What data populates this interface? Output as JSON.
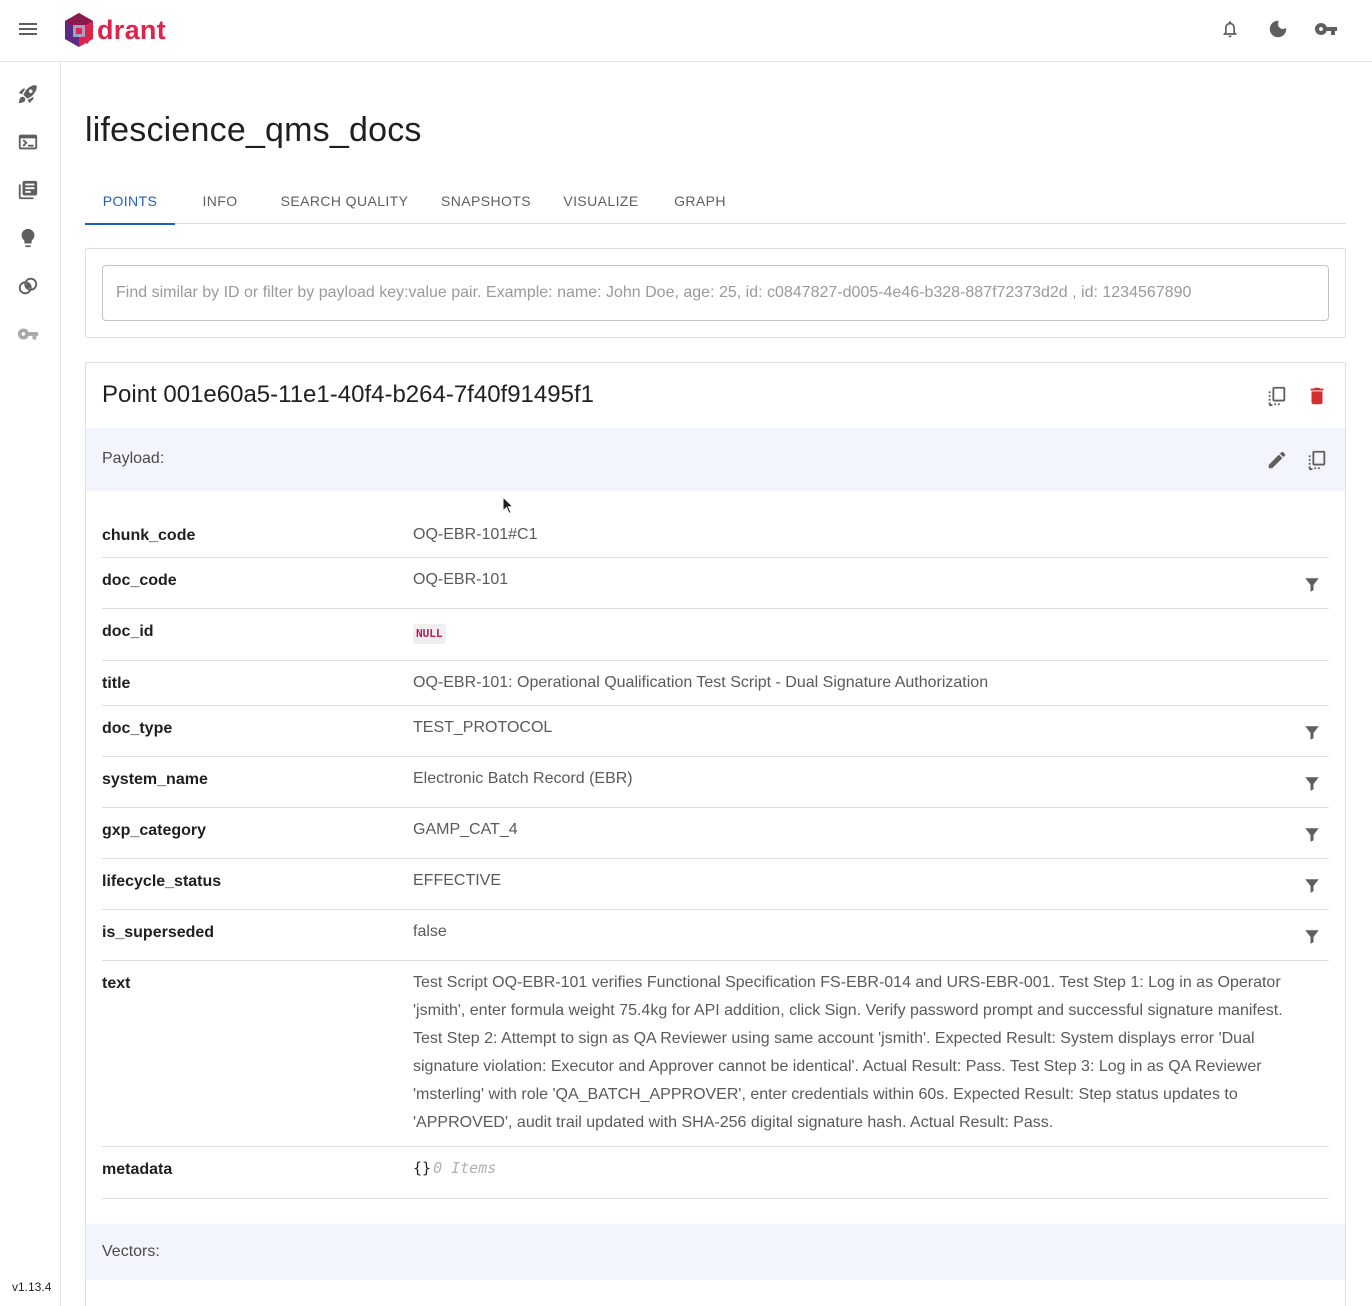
{
  "app": {
    "logo_text": "drant",
    "version": "v1.13.4"
  },
  "header": {
    "icons": [
      "bell-icon",
      "moon-icon",
      "key-icon"
    ]
  },
  "sidebar": {
    "items": [
      {
        "name": "welcome",
        "icon": "rocket-icon"
      },
      {
        "name": "console",
        "icon": "terminal-icon"
      },
      {
        "name": "collections",
        "icon": "library-icon"
      },
      {
        "name": "tutorial",
        "icon": "lightbulb-icon"
      },
      {
        "name": "datasets",
        "icon": "datasets-icon"
      },
      {
        "name": "access",
        "icon": "key-icon"
      }
    ]
  },
  "collection": {
    "title": "lifescience_qms_docs"
  },
  "tabs": [
    {
      "label": "POINTS",
      "active": true
    },
    {
      "label": "INFO",
      "active": false
    },
    {
      "label": "SEARCH QUALITY",
      "active": false
    },
    {
      "label": "SNAPSHOTS",
      "active": false
    },
    {
      "label": "VISUALIZE",
      "active": false
    },
    {
      "label": "GRAPH",
      "active": false
    }
  ],
  "search": {
    "value": "",
    "placeholder": "Find similar by ID or filter by payload key:value pair. Example: name: John Doe, age: 25, id: c0847827-d005-4e46-b328-887f72373d2d , id: 1234567890"
  },
  "point": {
    "title": "Point 001e60a5-11e1-40f4-b264-7f40f91495f1",
    "payload_label": "Payload:",
    "vectors_label": "Vectors:",
    "payload": [
      {
        "key": "chunk_code",
        "value": "OQ-EBR-101#C1",
        "filter": false
      },
      {
        "key": "doc_code",
        "value": "OQ-EBR-101",
        "filter": true
      },
      {
        "key": "doc_id",
        "value": "NULL",
        "filter": false
      },
      {
        "key": "title",
        "value": "OQ-EBR-101: Operational Qualification Test Script - Dual Signature Authorization",
        "filter": false
      },
      {
        "key": "doc_type",
        "value": "TEST_PROTOCOL",
        "filter": true
      },
      {
        "key": "system_name",
        "value": "Electronic Batch Record (EBR)",
        "filter": true
      },
      {
        "key": "gxp_category",
        "value": "GAMP_CAT_4",
        "filter": true
      },
      {
        "key": "lifecycle_status",
        "value": "EFFECTIVE",
        "filter": true
      },
      {
        "key": "is_superseded",
        "value": "false",
        "filter": true
      },
      {
        "key": "text",
        "value": "Test Script OQ-EBR-101 verifies Functional Specification FS-EBR-014 and URS-EBR-001. Test Step 1: Log in as Operator 'jsmith', enter formula weight 75.4kg for API addition, click Sign. Verify password prompt and successful signature manifest. Test Step 2: Attempt to sign as QA Reviewer using same account 'jsmith'. Expected Result: System displays error 'Dual signature violation: Executor and Approver cannot be identical'. Actual Result: Pass. Test Step 3: Log in as QA Reviewer 'msterling' with role 'QA_BATCH_APPROVER', enter credentials within 60s. Expected Result: Step status updates to 'APPROVED', audit trail updated with SHA-256 digital signature hash. Actual Result: Pass.",
        "filter": false
      },
      {
        "key": "metadata",
        "value": "{}",
        "count": "0 Items",
        "filter": false
      }
    ]
  },
  "colors": {
    "accent": "#1f5fbf",
    "delete": "#d32f2f",
    "logo": "#dc244c",
    "section_bg": "#f2f6fc"
  }
}
